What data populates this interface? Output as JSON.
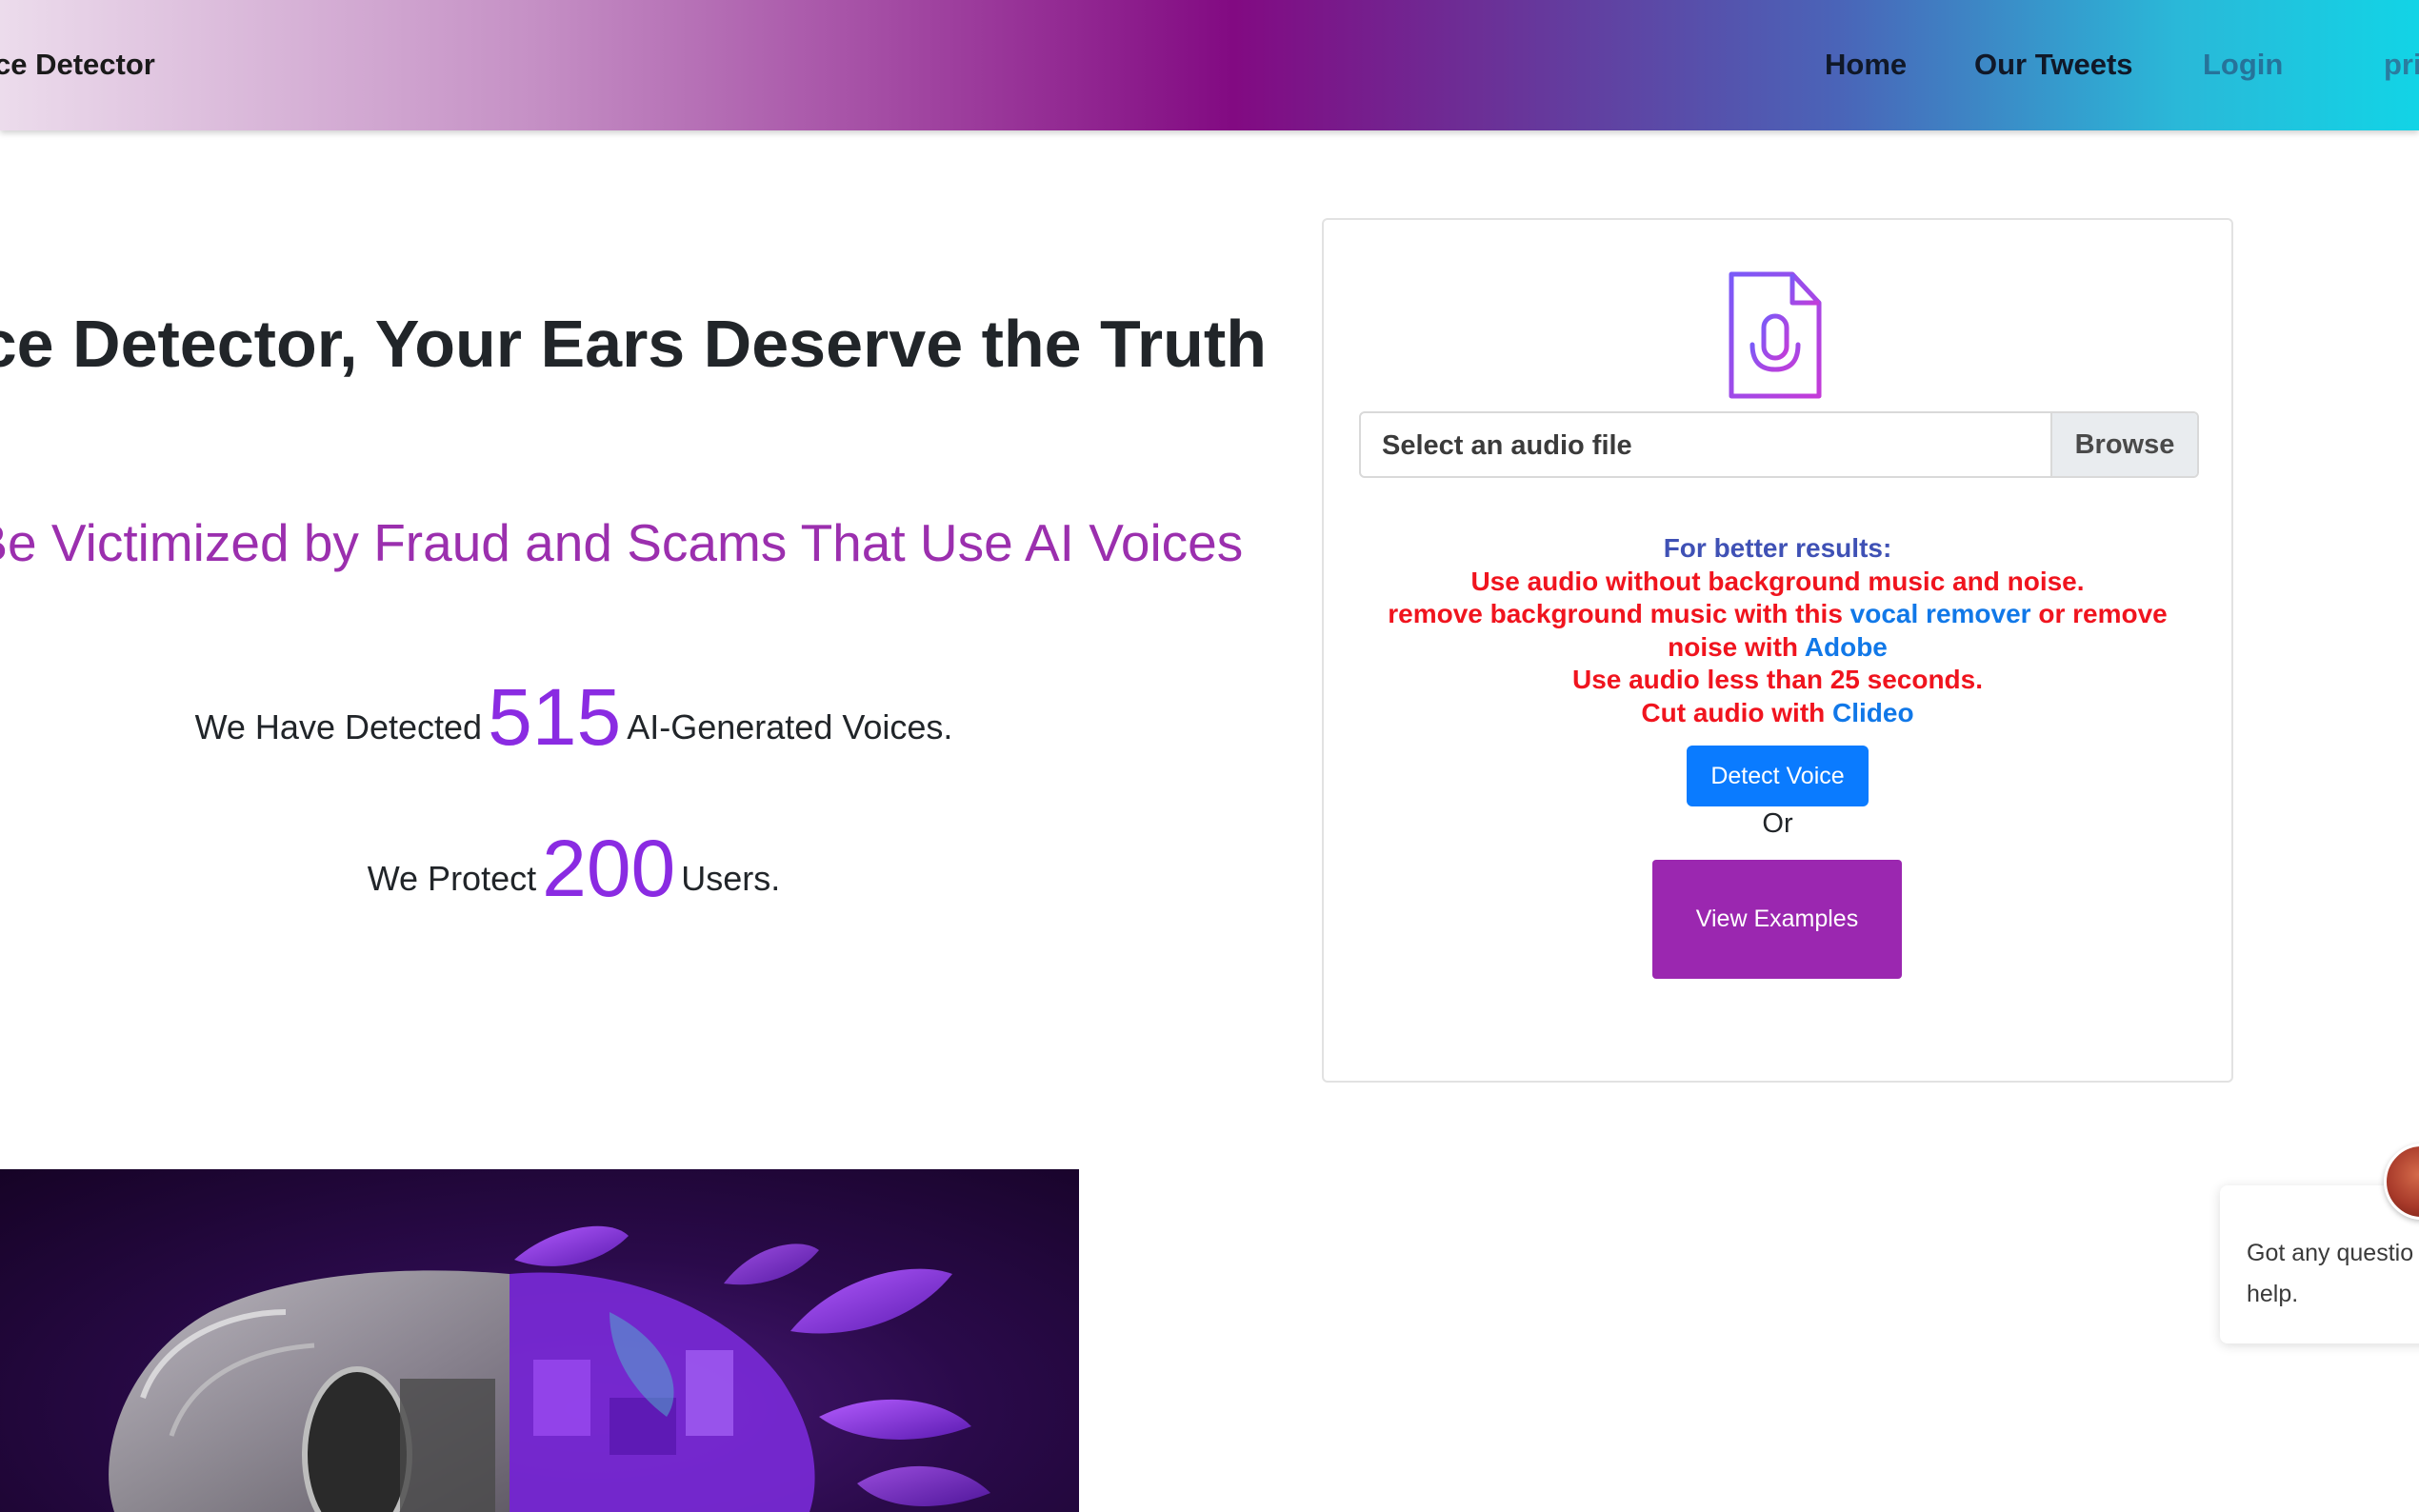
{
  "navbar": {
    "brand": "ce Detector",
    "links": [
      {
        "label": "Home"
      },
      {
        "label": "Our Tweets"
      },
      {
        "label": "Login"
      },
      {
        "label": "pri"
      }
    ]
  },
  "hero": {
    "title": "Voice Detector, Your Ears Deserve the Truth",
    "subtitle": "n't Be Victimized by Fraud and Scams That Use AI Voices",
    "stats": {
      "detected_prefix": "We Have Detected",
      "detected_count": "515",
      "detected_suffix": "AI-Generated Voices.",
      "protect_prefix": "We Protect",
      "protect_count": "200",
      "protect_suffix": "Users."
    }
  },
  "upload_card": {
    "file_icon": "audio-file-microphone-icon",
    "file_placeholder": "Select an audio file",
    "browse_label": "Browse",
    "tips": {
      "heading": "For better results:",
      "line1": "Use audio without background music and noise.",
      "line2_prefix": "remove background music with this",
      "line2_link": "vocal remover",
      "line2_mid": "or remove noise with",
      "line2_link2": "Adobe",
      "line3": "Use audio less than 25 seconds.",
      "line4_prefix": "Cut audio with",
      "line4_link": "Clideo"
    },
    "detect_label": "Detect Voice",
    "or_label": "Or",
    "examples_label": "View Examples"
  },
  "chat_widget": {
    "line1": "Got any questio",
    "line2": "help."
  },
  "colors": {
    "accent_purple": "#9b27b0",
    "primary_blue": "#0a7bff",
    "count_purple": "#8a2be2",
    "tip_red": "#f0141e",
    "tip_heading": "#3f51b5",
    "link_blue": "#1178e8"
  }
}
